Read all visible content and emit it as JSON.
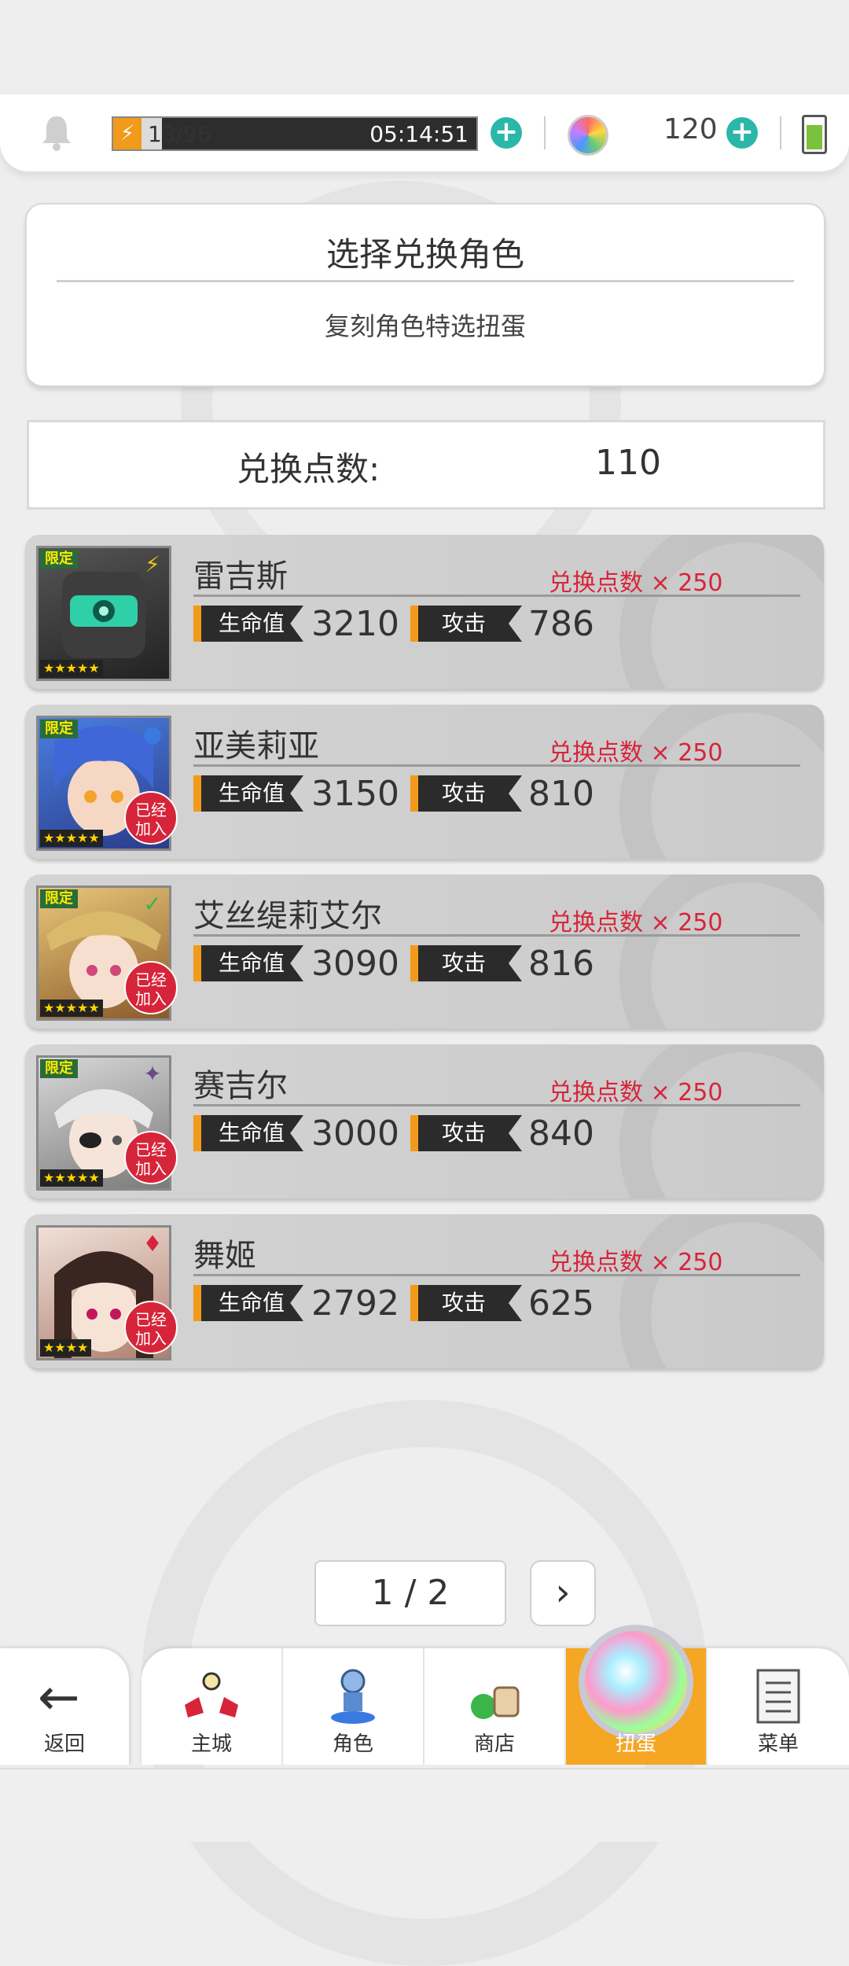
{
  "topbar": {
    "energy_value": "13/96",
    "energy_fraction": 0.135,
    "energy_timer": "05:14:51",
    "gem_count": "120",
    "icons": [
      "bell-icon",
      "energy-icon",
      "plus-icon",
      "gem-icon",
      "plus-icon",
      "battery-icon"
    ]
  },
  "header": {
    "title": "选择兑换角色",
    "subtitle": "复刻角色特选扭蛋"
  },
  "points": {
    "label": "兑换点数:",
    "value": "110"
  },
  "characters": [
    {
      "name": "雷吉斯",
      "cost": "兑换点数 × 250",
      "hp_label": "生命值",
      "hp": "3210",
      "atk_label": "攻击",
      "atk": "786",
      "limited": "限定",
      "stars": "★★★★★",
      "element": "⚡",
      "element_color": "#e8c21a",
      "joined": ""
    },
    {
      "name": "亚美莉亚",
      "cost": "兑换点数 × 250",
      "hp_label": "生命值",
      "hp": "3150",
      "atk_label": "攻击",
      "atk": "810",
      "limited": "限定",
      "stars": "★★★★★",
      "element": "●",
      "element_color": "#3a7ae0",
      "joined": "已经\n加入"
    },
    {
      "name": "艾丝缇莉艾尔",
      "cost": "兑换点数 × 250",
      "hp_label": "生命值",
      "hp": "3090",
      "atk_label": "攻击",
      "atk": "816",
      "limited": "限定",
      "stars": "★★★★★",
      "element": "✓",
      "element_color": "#3bb44a",
      "joined": "已经\n加入"
    },
    {
      "name": "赛吉尔",
      "cost": "兑换点数 × 250",
      "hp_label": "生命值",
      "hp": "3000",
      "atk_label": "攻击",
      "atk": "840",
      "limited": "限定",
      "stars": "★★★★★",
      "element": "✦",
      "element_color": "#6a4a8a",
      "joined": "已经\n加入"
    },
    {
      "name": "舞姬",
      "cost": "兑换点数 × 250",
      "hp_label": "生命值",
      "hp": "2792",
      "atk_label": "攻击",
      "atk": "625",
      "limited": "",
      "stars": "★★★★",
      "element": "♦",
      "element_color": "#d6253a",
      "joined": "已经\n加入"
    }
  ],
  "pager": {
    "text": "1 / 2",
    "next_icon": "chevron-right-icon"
  },
  "nav": {
    "back_label": "返回",
    "tabs": [
      {
        "label": "主城",
        "icon": "castle-icon"
      },
      {
        "label": "角色",
        "icon": "character-icon"
      },
      {
        "label": "商店",
        "icon": "shop-icon"
      },
      {
        "label": "扭蛋",
        "icon": "gacha-icon",
        "active": true
      },
      {
        "label": "菜单",
        "icon": "menu-icon"
      }
    ]
  },
  "colors": {
    "accent": "#f5a623",
    "cost_red": "#d6253a",
    "teal": "#2ab7a9"
  }
}
